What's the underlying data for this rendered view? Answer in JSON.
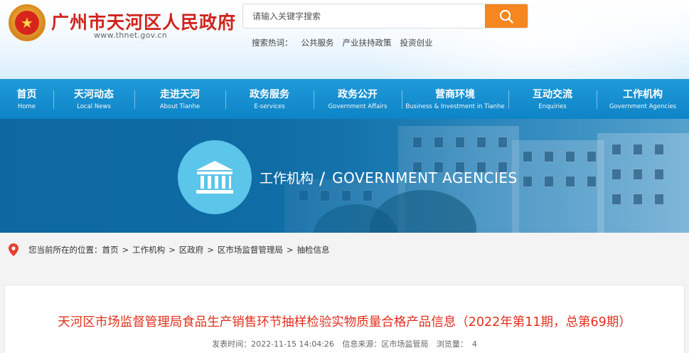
{
  "header": {
    "site_title": "广州市天河区人民政府",
    "site_url": "www.thnet.gov.cn",
    "emblem_glyph": "★",
    "search": {
      "placeholder": "请输入关键字搜索"
    },
    "hot_label": "搜索热词：",
    "hot_words": [
      "公共服务",
      "产业扶持政策",
      "投资创业"
    ]
  },
  "nav": {
    "items": [
      {
        "zh": "首页",
        "en": "Home"
      },
      {
        "zh": "天河动态",
        "en": "Local News"
      },
      {
        "zh": "走进天河",
        "en": "About Tianhe"
      },
      {
        "zh": "政务服务",
        "en": "E-services"
      },
      {
        "zh": "政务公开",
        "en": "Government Affairs"
      },
      {
        "zh": "营商环境",
        "en": "Business & Investment in Tianhe"
      },
      {
        "zh": "互动交流",
        "en": "Enquiries"
      },
      {
        "zh": "工作机构",
        "en": "Government Agencies"
      }
    ]
  },
  "banner": {
    "title_zh": "工作机构",
    "slash": "/",
    "title_en": "GOVERNMENT AGENCIES",
    "icon": "government-building-icon"
  },
  "breadcrumb": {
    "prefix": "您当前所在的位置：",
    "items": [
      "首页",
      "工作机构",
      "区政府",
      "区市场监督管理局",
      "抽检信息"
    ],
    "separator": ">"
  },
  "article": {
    "title": "天河区市场监督管理局食品生产销售环节抽样检验实物质量合格产品信息（2022年第11期，总第69期）",
    "publish_label": "发表时间：",
    "publish_time": "2022-11-15 14:04:26",
    "source_label": "信息来源：",
    "source": "区市场监管局",
    "views_label": "浏览量：",
    "views": "4"
  },
  "colors": {
    "nav_blue": "#1a93d3",
    "title_red": "#e0301e",
    "search_orange": "#f6861f",
    "site_title_red": "#d0241c"
  }
}
